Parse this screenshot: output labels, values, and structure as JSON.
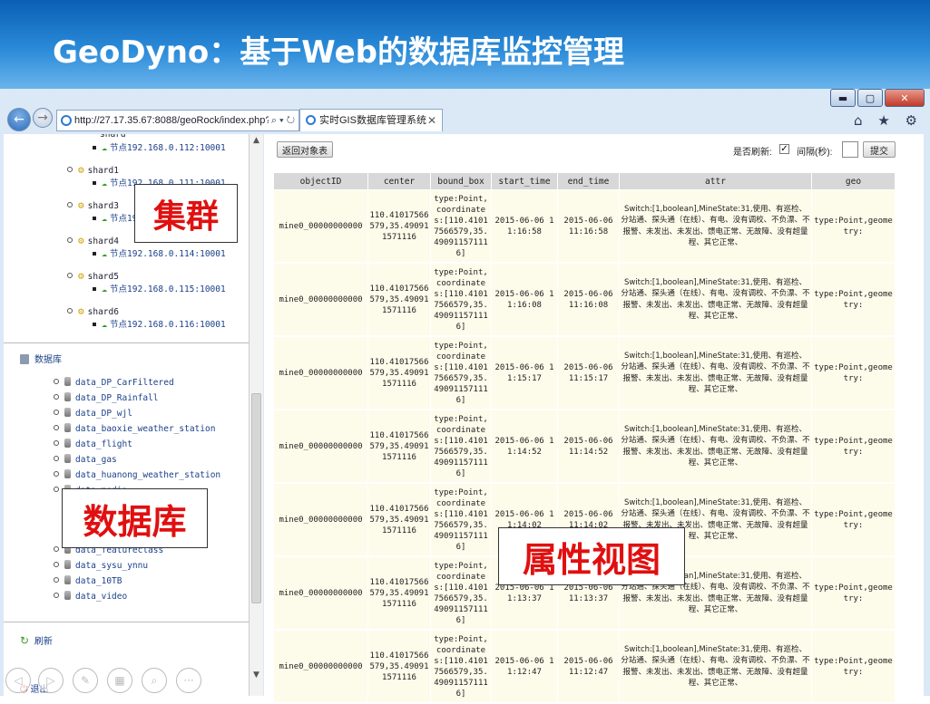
{
  "slide": {
    "title": "GeoDyno：基于Web的数据库监控管理"
  },
  "browser": {
    "url": "http://27.17.35.67:8088/geoRock/index.php?a",
    "tab_title": "实时GIS数据库管理系统",
    "win": {
      "minimize": "▬",
      "maximize": "▢",
      "close": "✕"
    },
    "addr_tools": "⌕ ▾ ↻",
    "right_icons": "⌂ ★ ⚙"
  },
  "tree": {
    "partial_top": "shard",
    "shards": [
      {
        "name": "shard1",
        "node": "节点192.168.0.111:10001"
      },
      {
        "name": "shard3",
        "node": "节点192.168.0.113:10001"
      },
      {
        "name": "shard4",
        "node": "节点192.168.0.114:10001"
      },
      {
        "name": "shard5",
        "node": "节点192.168.0.115:10001"
      },
      {
        "name": "shard6",
        "node": "节点192.168.0.116:10001"
      }
    ],
    "first_node": "节点192.168.0.112:10001",
    "db_header": "数据库",
    "databases": [
      "data_DP_CarFiltered",
      "data_DP_Rainfall",
      "data_DP_wjl",
      "data_baoxie_weather_station",
      "data_flight",
      "data_gas",
      "data_huanong_weather_station",
      "data_media"
    ],
    "databases_lower": [
      "data_featureclass",
      "data_sysu_ynnu",
      "data_10TB",
      "data_video"
    ],
    "refresh": "刷新",
    "logout": "退出"
  },
  "overlays": {
    "cluster": "集群",
    "database": "数据库",
    "attr_view": "属性视图"
  },
  "toolbar": {
    "back_button": "返回对象表",
    "auto_refresh_label": "是否刷新:",
    "checkbox_mark": "✓",
    "interval_label": "间隔(秒):",
    "submit_button": "提交"
  },
  "table": {
    "headers": [
      "objectID",
      "center",
      "bound_box",
      "start_time",
      "end_time",
      "attr",
      "geo"
    ],
    "rows": [
      {
        "objectID": "mine0_00000000000",
        "center": "110.41017566579,35.490911571116",
        "bound_box": "type:Point,coordinates:[110.41017566579,35.490911571116]",
        "start_time": "2015-06-06 11:16:58",
        "end_time": "2015-06-06 11:16:58",
        "attr": "Switch:[1,boolean],MineState:31,使用、有巡检、分站通、探头通（在线）、有电、没有调校、不负漂、不报警、未发出、未发出、馈电正常、无故障、没有超量程、其它正常、",
        "geo": "type:Point,geometry:"
      },
      {
        "objectID": "mine0_00000000000",
        "center": "110.41017566579,35.490911571116",
        "bound_box": "type:Point,coordinates:[110.41017566579,35.490911571116]",
        "start_time": "2015-06-06 11:16:08",
        "end_time": "2015-06-06 11:16:08",
        "attr": "Switch:[1,boolean],MineState:31,使用、有巡检、分站通、探头通（在线）、有电、没有调校、不负漂、不报警、未发出、未发出、馈电正常、无故障、没有超量程、其它正常、",
        "geo": "type:Point,geometry:"
      },
      {
        "objectID": "mine0_00000000000",
        "center": "110.41017566579,35.490911571116",
        "bound_box": "type:Point,coordinates:[110.41017566579,35.490911571116]",
        "start_time": "2015-06-06 11:15:17",
        "end_time": "2015-06-06 11:15:17",
        "attr": "Switch:[1,boolean],MineState:31,使用、有巡检、分站通、探头通（在线）、有电、没有调校、不负漂、不报警、未发出、未发出、馈电正常、无故障、没有超量程、其它正常、",
        "geo": "type:Point,geometry:"
      },
      {
        "objectID": "mine0_00000000000",
        "center": "110.41017566579,35.490911571116",
        "bound_box": "type:Point,coordinates:[110.41017566579,35.490911571116]",
        "start_time": "2015-06-06 11:14:52",
        "end_time": "2015-06-06 11:14:52",
        "attr": "Switch:[1,boolean],MineState:31,使用、有巡检、分站通、探头通（在线）、有电、没有调校、不负漂、不报警、未发出、未发出、馈电正常、无故障、没有超量程、其它正常、",
        "geo": "type:Point,geometry:"
      },
      {
        "objectID": "mine0_00000000000",
        "center": "110.41017566579,35.490911571116",
        "bound_box": "type:Point,coordinates:[110.41017566579,35.490911571116]",
        "start_time": "2015-06-06 11:14:02",
        "end_time": "2015-06-06 11:14:02",
        "attr": "Switch:[1,boolean],MineState:31,使用、有巡检、分站通、探头通（在线）、有电、没有调校、不负漂、不报警、未发出、未发出、馈电正常、无故障、没有超量程、其它正常、",
        "geo": "type:Point,geometry:"
      },
      {
        "objectID": "mine0_00000000000",
        "center": "110.41017566579,35.490911571116",
        "bound_box": "type:Point,coordinates:[110.41017566579,35.490911571116]",
        "start_time": "2015-06-06 11:13:37",
        "end_time": "2015-06-06 11:13:37",
        "attr": "Switch:[1,boolean],MineState:31,使用、有巡检、分站通、探头通（在线）、有电、没有调校、不负漂、不报警、未发出、未发出、馈电正常、无故障、没有超量程、其它正常、",
        "geo": "type:Point,geometry:"
      },
      {
        "objectID": "mine0_00000000000",
        "center": "110.41017566579,35.490911571116",
        "bound_box": "type:Point,coordinates:[110.41017566579,35.490911571116]",
        "start_time": "2015-06-06 11:12:47",
        "end_time": "2015-06-06 11:12:47",
        "attr": "Switch:[1,boolean],MineState:31,使用、有巡检、分站通、探头通（在线）、有电、没有调校、不负漂、不报警、未发出、未发出、馈电正常、无故障、没有超量程、其它正常、",
        "geo": "type:Point,geometry:"
      }
    ]
  },
  "bottom_toolbar": [
    "◁",
    "▷",
    "✎",
    "▦",
    "⌕",
    "···"
  ]
}
